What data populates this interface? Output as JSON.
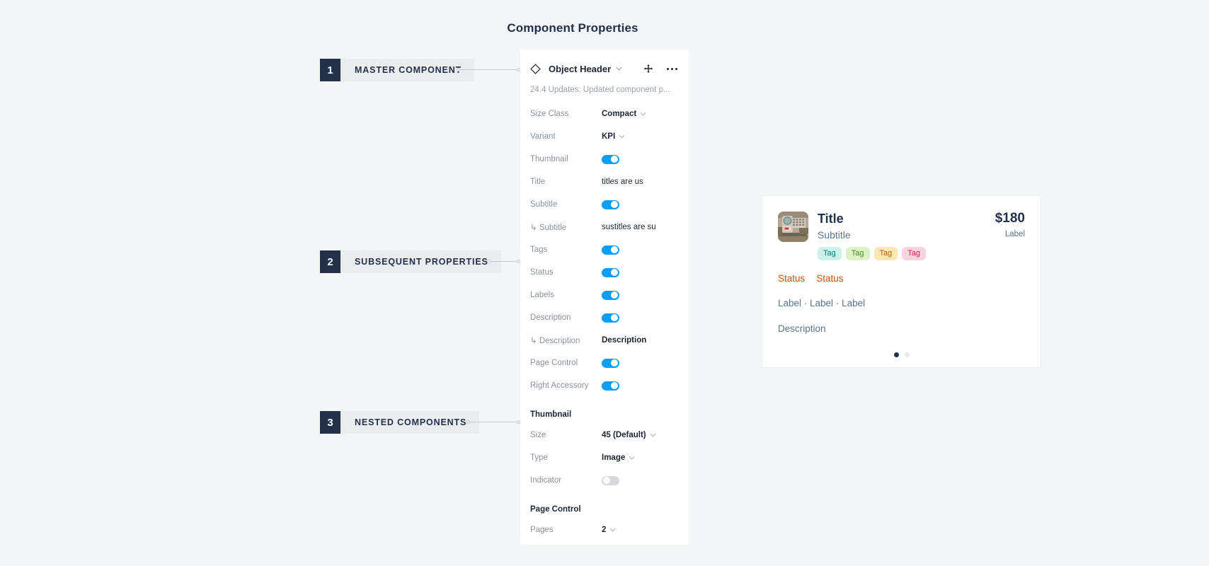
{
  "page": {
    "title": "Component Properties",
    "background_color": "#f4f5f7"
  },
  "callouts": [
    {
      "number": "1",
      "label": "MASTER COMPONENT"
    },
    {
      "number": "2",
      "label": "SUBSEQUENT PROPERTIES"
    },
    {
      "number": "3",
      "label": "NESTED COMPONENTS"
    }
  ],
  "panel": {
    "component_name": "Object Header",
    "icon": "diamond-icon",
    "move_icon": "move-arrows-icon",
    "overflow_icon": "ellipsis-icon",
    "caret_icon": "chevron-down-icon",
    "note": "24.4 Updates: Updated component p...",
    "rows": [
      {
        "label": "Size Class",
        "type": "select",
        "value": "Compact"
      },
      {
        "label": "Variant",
        "type": "select",
        "value": "KPI"
      },
      {
        "label": "Thumbnail",
        "type": "toggle",
        "value": "on"
      },
      {
        "label": "Title",
        "type": "text",
        "value": "titles are us"
      },
      {
        "label": "Subtitle",
        "type": "toggle",
        "value": "on"
      },
      {
        "label": "↳ Subtitle",
        "type": "text",
        "value": "sustitles are su"
      },
      {
        "label": "Tags",
        "type": "toggle",
        "value": "on"
      },
      {
        "label": "Status",
        "type": "toggle",
        "value": "on"
      },
      {
        "label": "Labels",
        "type": "toggle",
        "value": "on"
      },
      {
        "label": "Description",
        "type": "toggle",
        "value": "on"
      },
      {
        "label": "↳ Description",
        "type": "text",
        "value": "Description"
      },
      {
        "label": "Page Control",
        "type": "toggle",
        "value": "on"
      },
      {
        "label": "Right Accessory",
        "type": "toggle",
        "value": "on"
      }
    ],
    "sections": [
      {
        "heading": "Thumbnail",
        "rows": [
          {
            "label": "Size",
            "type": "select",
            "value": "45 (Default)"
          },
          {
            "label": "Type",
            "type": "select",
            "value": "Image"
          },
          {
            "label": "Indicator",
            "type": "toggle",
            "value": "off"
          }
        ]
      },
      {
        "heading": "Page Control",
        "rows": [
          {
            "label": "Pages",
            "type": "select",
            "value": "2"
          }
        ]
      }
    ]
  },
  "preview_card": {
    "thumbnail_alt": "industrial-gauge-photo",
    "title": "Title",
    "subtitle": "Subtitle",
    "tags": [
      {
        "text": "Tag",
        "bg": "#c9f3e8",
        "fg": "#0a7a6c"
      },
      {
        "text": "Tag",
        "bg": "#ddf1c4",
        "fg": "#4a8a22"
      },
      {
        "text": "Tag",
        "bg": "#fbe7b0",
        "fg": "#b3630a"
      },
      {
        "text": "Tag",
        "bg": "#fbd3de",
        "fg": "#c0265a"
      }
    ],
    "kpi_value": "$180",
    "kpi_label": "Label",
    "statuses": [
      "Status",
      "Status"
    ],
    "labels_line": "Label · Label · Label",
    "description": "Description",
    "pages": 2,
    "active_page": 1
  },
  "colors": {
    "toggle_on": "#0a9ef0",
    "toggle_off": "#d6d9de",
    "callout_badge": "#22304a",
    "callout_pill": "#ebecee",
    "status_text": "#c4520a",
    "muted_text": "#5b738b"
  }
}
